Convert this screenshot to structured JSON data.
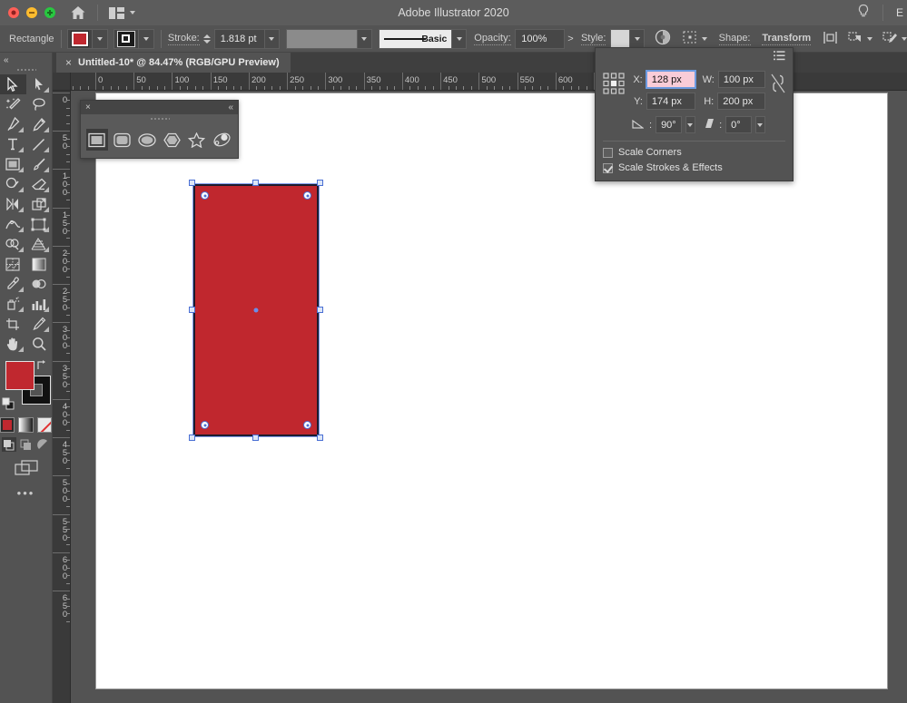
{
  "titlebar": {
    "app_title": "Adobe Illustrator 2020",
    "home_icon": "home-icon",
    "arrange_icon": "arrange-documents-icon",
    "lightbulb_icon": "lightbulb-icon",
    "edge_letter": "E",
    "window_controls": [
      "close",
      "minimize",
      "maximize"
    ]
  },
  "controlbar": {
    "object_label": "Rectangle",
    "fill_color": "#C0282F",
    "fill_swatch_name": "fill-color-swatch",
    "stroke_swatch_name": "stroke-color-swatch",
    "stroke_label": "Stroke:",
    "stroke_weight": "1.818 pt",
    "variable_width_name": "variable-width-profile",
    "brush_profile": "Basic",
    "opacity_label": "Opacity:",
    "opacity_value": "100%",
    "opacity_more": ">",
    "style_label": "Style:",
    "recolor_icon": "recolor-artwork-icon",
    "align_icon": "align-to-icon",
    "shape_label": "Shape:",
    "transform_label": "Transform",
    "isolate_icon": "isolate-selected-object-icon",
    "mask_icon": "select-similar-objects-icon",
    "pen_edit_icon": "edit-toolbar-icon"
  },
  "document_tab": {
    "close_glyph": "×",
    "title": "Untitled-10* @ 84.47% (RGB/GPU Preview)"
  },
  "rulers": {
    "horizontal_labels": [
      "0",
      "50",
      "100",
      "150",
      "200",
      "250",
      "300",
      "350",
      "400",
      "450",
      "500",
      "550",
      "600",
      "6"
    ],
    "vertical_labels": [
      "0",
      "50",
      "100",
      "150",
      "200",
      "250",
      "300",
      "350",
      "400",
      "450"
    ],
    "unit_step": 50
  },
  "toolbar": {
    "collapse_glyph": "«",
    "more_glyph": "•••",
    "tools": [
      {
        "name": "selection-tool",
        "selected": true,
        "has_flyout": false
      },
      {
        "name": "direct-selection-tool",
        "selected": false,
        "has_flyout": true
      },
      {
        "name": "magic-wand-tool",
        "selected": false,
        "has_flyout": false
      },
      {
        "name": "lasso-tool",
        "selected": false,
        "has_flyout": false
      },
      {
        "name": "pen-tool",
        "selected": false,
        "has_flyout": true
      },
      {
        "name": "curvature-tool",
        "selected": false,
        "has_flyout": false
      },
      {
        "name": "type-tool",
        "selected": false,
        "has_flyout": true
      },
      {
        "name": "line-segment-tool",
        "selected": false,
        "has_flyout": true
      },
      {
        "name": "rectangle-tool",
        "selected": false,
        "has_flyout": true
      },
      {
        "name": "paintbrush-tool",
        "selected": false,
        "has_flyout": true
      },
      {
        "name": "shaper-tool",
        "selected": false,
        "has_flyout": true
      },
      {
        "name": "eraser-tool",
        "selected": false,
        "has_flyout": true
      },
      {
        "name": "rotate-tool",
        "selected": false,
        "has_flyout": true
      },
      {
        "name": "scale-tool",
        "selected": false,
        "has_flyout": true
      },
      {
        "name": "width-tool",
        "selected": false,
        "has_flyout": true
      },
      {
        "name": "free-transform-tool",
        "selected": false,
        "has_flyout": true
      },
      {
        "name": "shape-builder-tool",
        "selected": false,
        "has_flyout": true
      },
      {
        "name": "perspective-grid-tool",
        "selected": false,
        "has_flyout": true
      },
      {
        "name": "mesh-tool",
        "selected": false,
        "has_flyout": false
      },
      {
        "name": "gradient-tool",
        "selected": false,
        "has_flyout": false
      },
      {
        "name": "eyedropper-tool",
        "selected": false,
        "has_flyout": true
      },
      {
        "name": "blend-tool",
        "selected": false,
        "has_flyout": false
      },
      {
        "name": "symbol-sprayer-tool",
        "selected": false,
        "has_flyout": true
      },
      {
        "name": "column-graph-tool",
        "selected": false,
        "has_flyout": true
      },
      {
        "name": "artboard-tool",
        "selected": false,
        "has_flyout": false
      },
      {
        "name": "slice-tool",
        "selected": false,
        "has_flyout": true
      },
      {
        "name": "hand-tool",
        "selected": false,
        "has_flyout": true
      },
      {
        "name": "zoom-tool",
        "selected": false,
        "has_flyout": false
      }
    ],
    "fill_color": "#C0282F",
    "stroke_color": "#111111",
    "swap_icon": "swap-fill-stroke-icon",
    "default_icon": "default-fill-stroke-icon",
    "mini_swatches": [
      "color-swatch",
      "gradient-swatch",
      "none-swatch"
    ],
    "draw_modes": [
      "draw-normal",
      "draw-behind",
      "draw-inside"
    ],
    "screen_mode_icon": "change-screen-mode-icon"
  },
  "shape_panel": {
    "close_glyph": "×",
    "collapse_glyph": "«",
    "tools": [
      {
        "name": "rectangle-tool",
        "selected": true
      },
      {
        "name": "rounded-rectangle-tool",
        "selected": false
      },
      {
        "name": "ellipse-tool",
        "selected": false
      },
      {
        "name": "polygon-tool",
        "selected": false
      },
      {
        "name": "star-tool",
        "selected": false
      },
      {
        "name": "flare-tool",
        "selected": false
      }
    ]
  },
  "transform_panel": {
    "menu_icon": "panel-menu-icon",
    "reference_point_name": "reference-point-grid",
    "reference_point_selected": "center",
    "x_label": "X:",
    "x_value": "128 px",
    "y_label": "Y:",
    "y_value": "174 px",
    "w_label": "W:",
    "w_value": "100 px",
    "h_label": "H:",
    "h_value": "200 px",
    "link_icon": "constrain-proportions-unlinked-icon",
    "angle_icon": "rotate-angle-icon",
    "angle_value": "90°",
    "shear_icon": "shear-angle-icon",
    "shear_value": "0°",
    "scale_corners_label": "Scale Corners",
    "scale_corners_checked": false,
    "scale_strokes_label": "Scale Strokes & Effects",
    "scale_strokes_checked": true,
    "active_field": "x"
  },
  "canvas": {
    "shape_name": "selected-rectangle",
    "shape_fill": "#C0272E",
    "shape_stroke": "#1C1C2E",
    "selection_color": "#4A6FD4"
  }
}
